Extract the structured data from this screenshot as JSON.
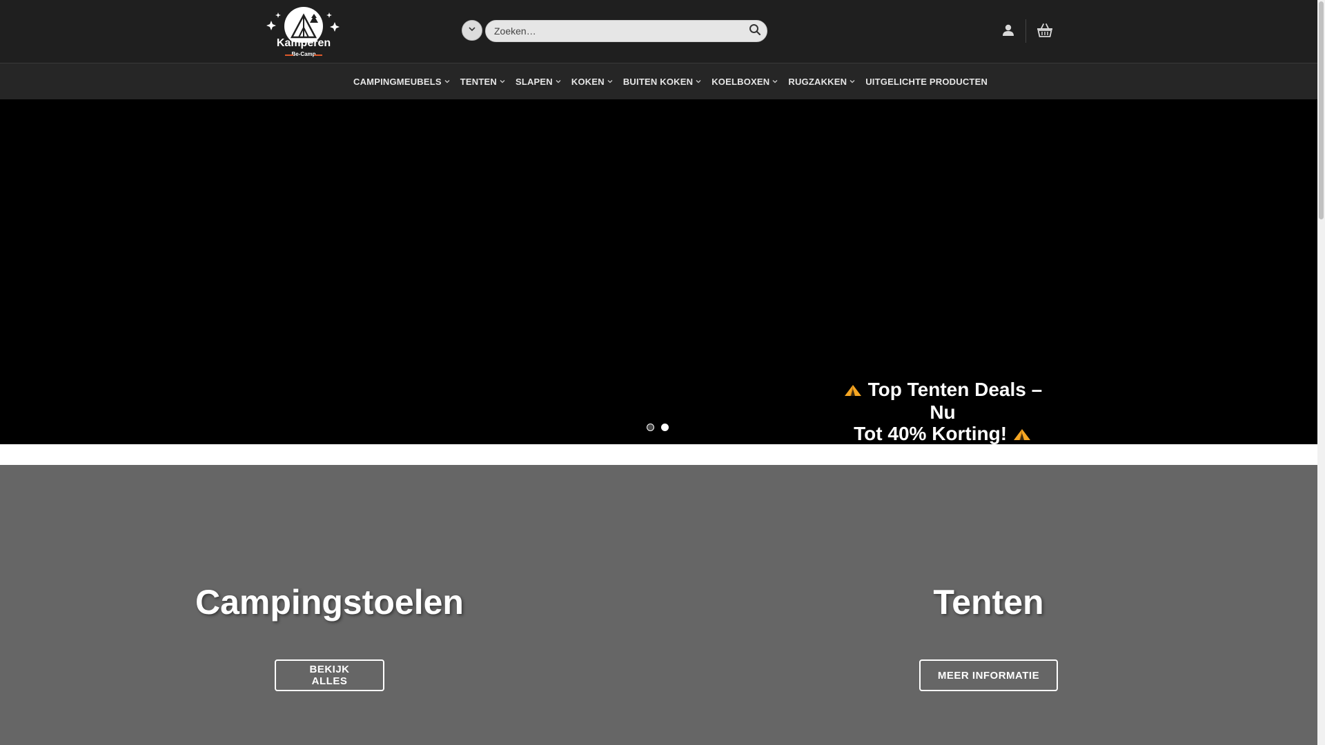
{
  "header": {
    "logo": {
      "text": "Kamperen",
      "subtext": "Be-Camp"
    },
    "search": {
      "placeholder": "Zoeken…"
    },
    "icons": {
      "dropdown": "chevron-down-icon",
      "search": "search-icon",
      "account": "user-icon",
      "cart": "basket-icon"
    }
  },
  "nav": {
    "items": [
      {
        "label": "CAMPINGMEUBELS",
        "dropdown": true
      },
      {
        "label": "TENTEN",
        "dropdown": true
      },
      {
        "label": "SLAPEN",
        "dropdown": true
      },
      {
        "label": "KOKEN",
        "dropdown": true
      },
      {
        "label": "BUITEN KOKEN",
        "dropdown": true
      },
      {
        "label": "KOELBOXEN",
        "dropdown": true
      },
      {
        "label": "RUGZAKKEN",
        "dropdown": true
      },
      {
        "label": "UITGELICHTE PRODUCTEN",
        "dropdown": false
      }
    ]
  },
  "hero": {
    "line1": "Top Tenten Deals – Nu",
    "line2": "Tot 40% Korting!",
    "slide_count": 2,
    "active_slide": 2
  },
  "categories": [
    {
      "title": "Campingstoelen",
      "button": "BEKIJK ALLES"
    },
    {
      "title": "Tenten",
      "button": "MEER INFORMATIE"
    }
  ],
  "colors": {
    "header_bg": "#1f1f1f",
    "nav_bg": "#262626",
    "hero_bg": "#000000",
    "category_bg": "#666666",
    "tent_icon": "#f5a623"
  }
}
